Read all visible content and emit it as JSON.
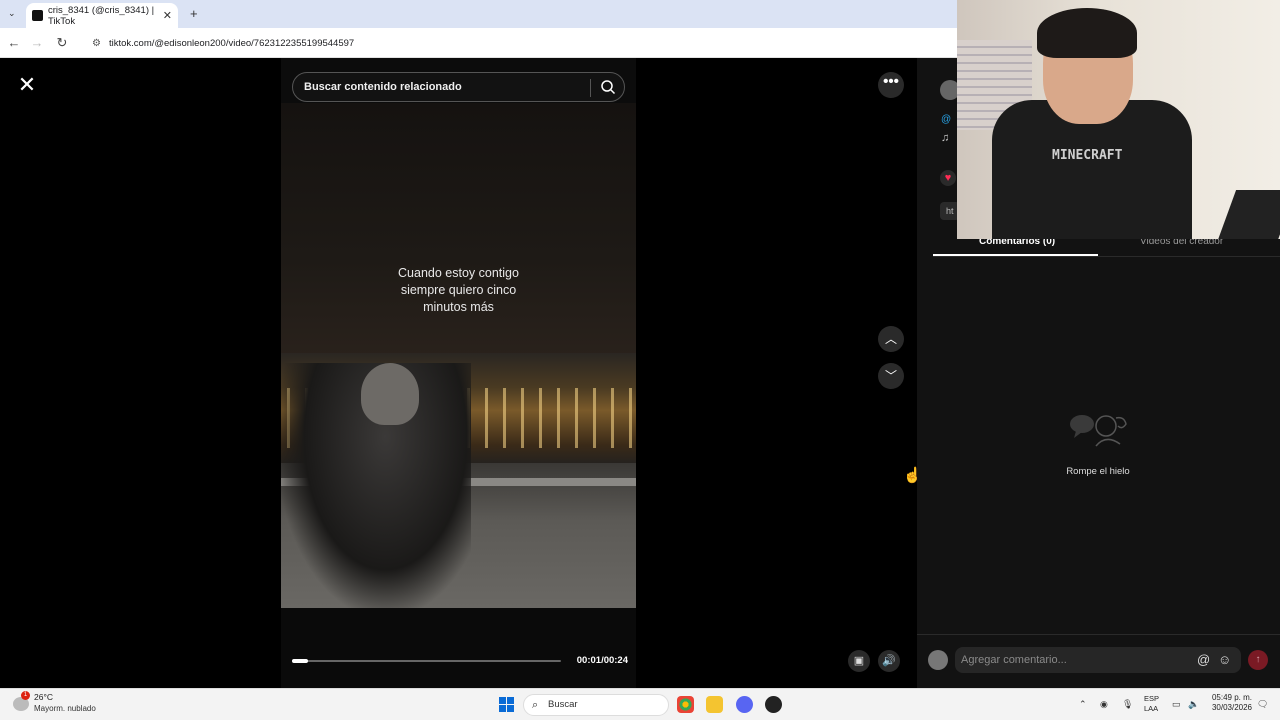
{
  "browser": {
    "tab_title": "cris_8341 (@cris_8341) | TikTok",
    "tab_close": "✕",
    "new_tab": "+",
    "url": "tiktok.com/@edisonleon200/video/7623122355199544597"
  },
  "video": {
    "search_placeholder": "Buscar contenido relacionado",
    "caption_line1": "Cuando estoy contigo",
    "caption_line2": "siempre quiero cinco",
    "caption_line3": "minutos más",
    "timecode": "00:01/00:24",
    "progress_fraction": 0.06
  },
  "panel": {
    "at_symbol": "@",
    "note_symbol": "♫",
    "link_text": "ht",
    "tab_comments": "Comentarios (0)",
    "tab_creator": "Videos del creador",
    "empty_text": "Rompe el hielo",
    "comment_placeholder": "Agregar comentario...",
    "at_btn": "@",
    "emoji_btn": "☺"
  },
  "webcam": {
    "shirt_logo": "MINECRAFT"
  },
  "taskbar": {
    "temperature": "26°C",
    "weather": "Mayorm. nublado",
    "weather_badge": "1",
    "search": "Buscar",
    "lang_line1": "ESP",
    "lang_line2": "LAA",
    "time": "05:49 p. m.",
    "date": "30/03/2026"
  },
  "colors": {
    "accent": "#fe2c55",
    "link": "#29a3e6",
    "panel_bg": "#121212",
    "windows_blue": "#0a6bd6"
  }
}
